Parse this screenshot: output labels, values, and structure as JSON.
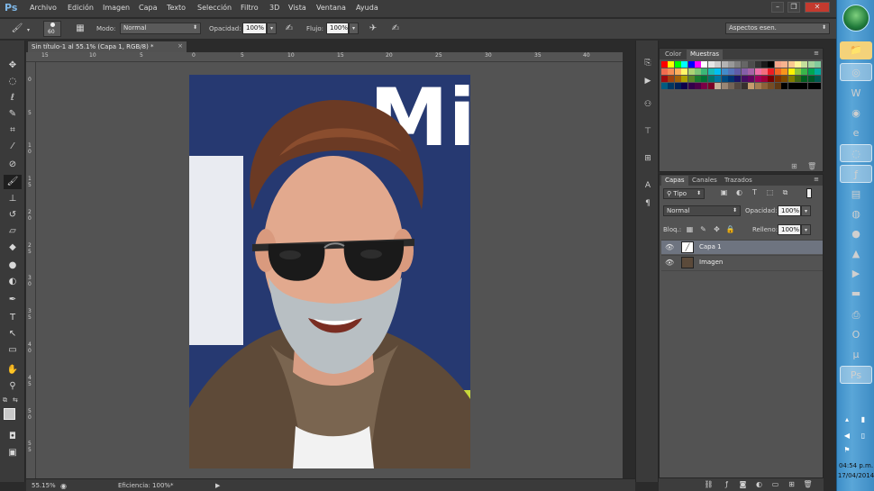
{
  "app": {
    "logo": "Ps"
  },
  "menu": [
    "Archivo",
    "Edición",
    "Imagen",
    "Capa",
    "Texto",
    "Selección",
    "Filtro",
    "3D",
    "Vista",
    "Ventana",
    "Ayuda"
  ],
  "options_bar": {
    "brush_size": "60",
    "mode_label": "Modo:",
    "mode_value": "Normal",
    "opacity_label": "Opacidad:",
    "opacity_value": "100%",
    "flow_label": "Flujo:",
    "flow_value": "100%",
    "workspace": "Aspectos esen."
  },
  "document": {
    "tab_title": "Sin título-1 al 55.1% (Capa 1, RGB/8) *",
    "ruler_h": [
      "15",
      "10",
      "5",
      "0",
      "5",
      "10",
      "15",
      "20",
      "25",
      "30",
      "35",
      "40"
    ],
    "ruler_v": [
      "0",
      "5",
      "1 0",
      "1 5",
      "2 0",
      "2 5",
      "3 0",
      "3 5",
      "4 0",
      "4 5",
      "5 0",
      "5 5"
    ],
    "photo_text": "Mi AW"
  },
  "status": {
    "zoom": "55.15%",
    "info": "Eficiencia: 100%*"
  },
  "swatch_panel": {
    "tabs": [
      "Color",
      "Muestras"
    ],
    "active_tab": "Muestras"
  },
  "layers_panel": {
    "tabs": [
      "Capas",
      "Canales",
      "Trazados"
    ],
    "active_tab": "Capas",
    "filter_label": "Tipo",
    "blend_mode": "Normal",
    "opacity_label": "Opacidad:",
    "opacity_value": "100%",
    "lock_label": "Bloq.:",
    "fill_label": "Relleno:",
    "fill_value": "100%",
    "layers": [
      {
        "name": "Capa 1",
        "selected": true
      },
      {
        "name": "Imagen",
        "selected": false
      }
    ]
  },
  "taskbar": {
    "time": "04:54 p.m.",
    "date": "17/04/2014"
  },
  "colors": {
    "accent_blue": "#3d8ec8",
    "selected_layer": "#6e7480",
    "canvas_bg": "#535353"
  }
}
